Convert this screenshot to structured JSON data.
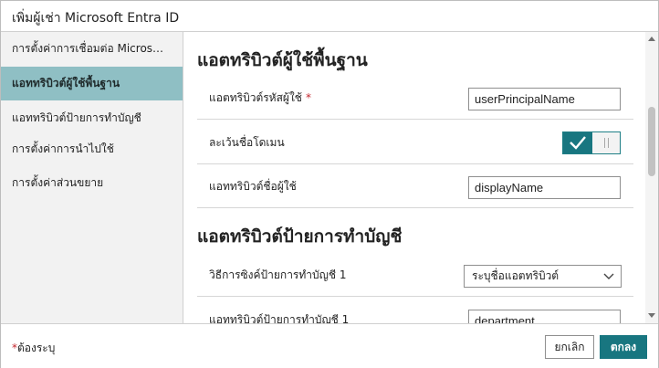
{
  "dialog": {
    "title": "เพิ่มผู้เช่า Microsoft Entra ID"
  },
  "sidebar": {
    "items": [
      {
        "label": "การตั้งค่าการเชื่อมต่อ Microsoft Entra ID"
      },
      {
        "label": "แอททริบิวต์ผู้ใช้พื้นฐาน",
        "active": true
      },
      {
        "label": "แอททริบิวต์ป้ายการทำบัญชี"
      },
      {
        "label": "การตั้งค่าการนำไปใช้"
      },
      {
        "label": "การตั้งค่าส่วนขยาย"
      }
    ]
  },
  "basic_section": {
    "title": "แอตทริบิวต์ผู้ใช้พื้นฐาน",
    "user_id_label": "แอตทริบิวต์รหัสผู้ใช้",
    "user_id_required_mark": "*",
    "user_id_value": "userPrincipalName",
    "ignore_domain_label": "ละเว้นชื่อโดเมน",
    "ignore_domain_enabled": true,
    "username_label": "แอททริบิวต์ชื่อผู้ใช้",
    "username_value": "displayName"
  },
  "account_label_section": {
    "title": "แอตทริบิวต์ป้ายการทำบัญชี",
    "sync_method_label": "วิธีการซิงค์ป้ายการทำบัญชี 1",
    "sync_method_value": "ระบุชื่อแอตทริบิวต์",
    "attribute_label": "แอททริบิวต์ป้ายการทำบัญชี 1",
    "attribute_value": "department"
  },
  "footer": {
    "required_star": "*",
    "required_text": "ต้องระบุ",
    "cancel_label": "ยกเลิก",
    "ok_label": "ตกลง"
  },
  "colors": {
    "accent": "#187680",
    "active_nav": "#8fbfc4",
    "required": "#c4262e"
  }
}
